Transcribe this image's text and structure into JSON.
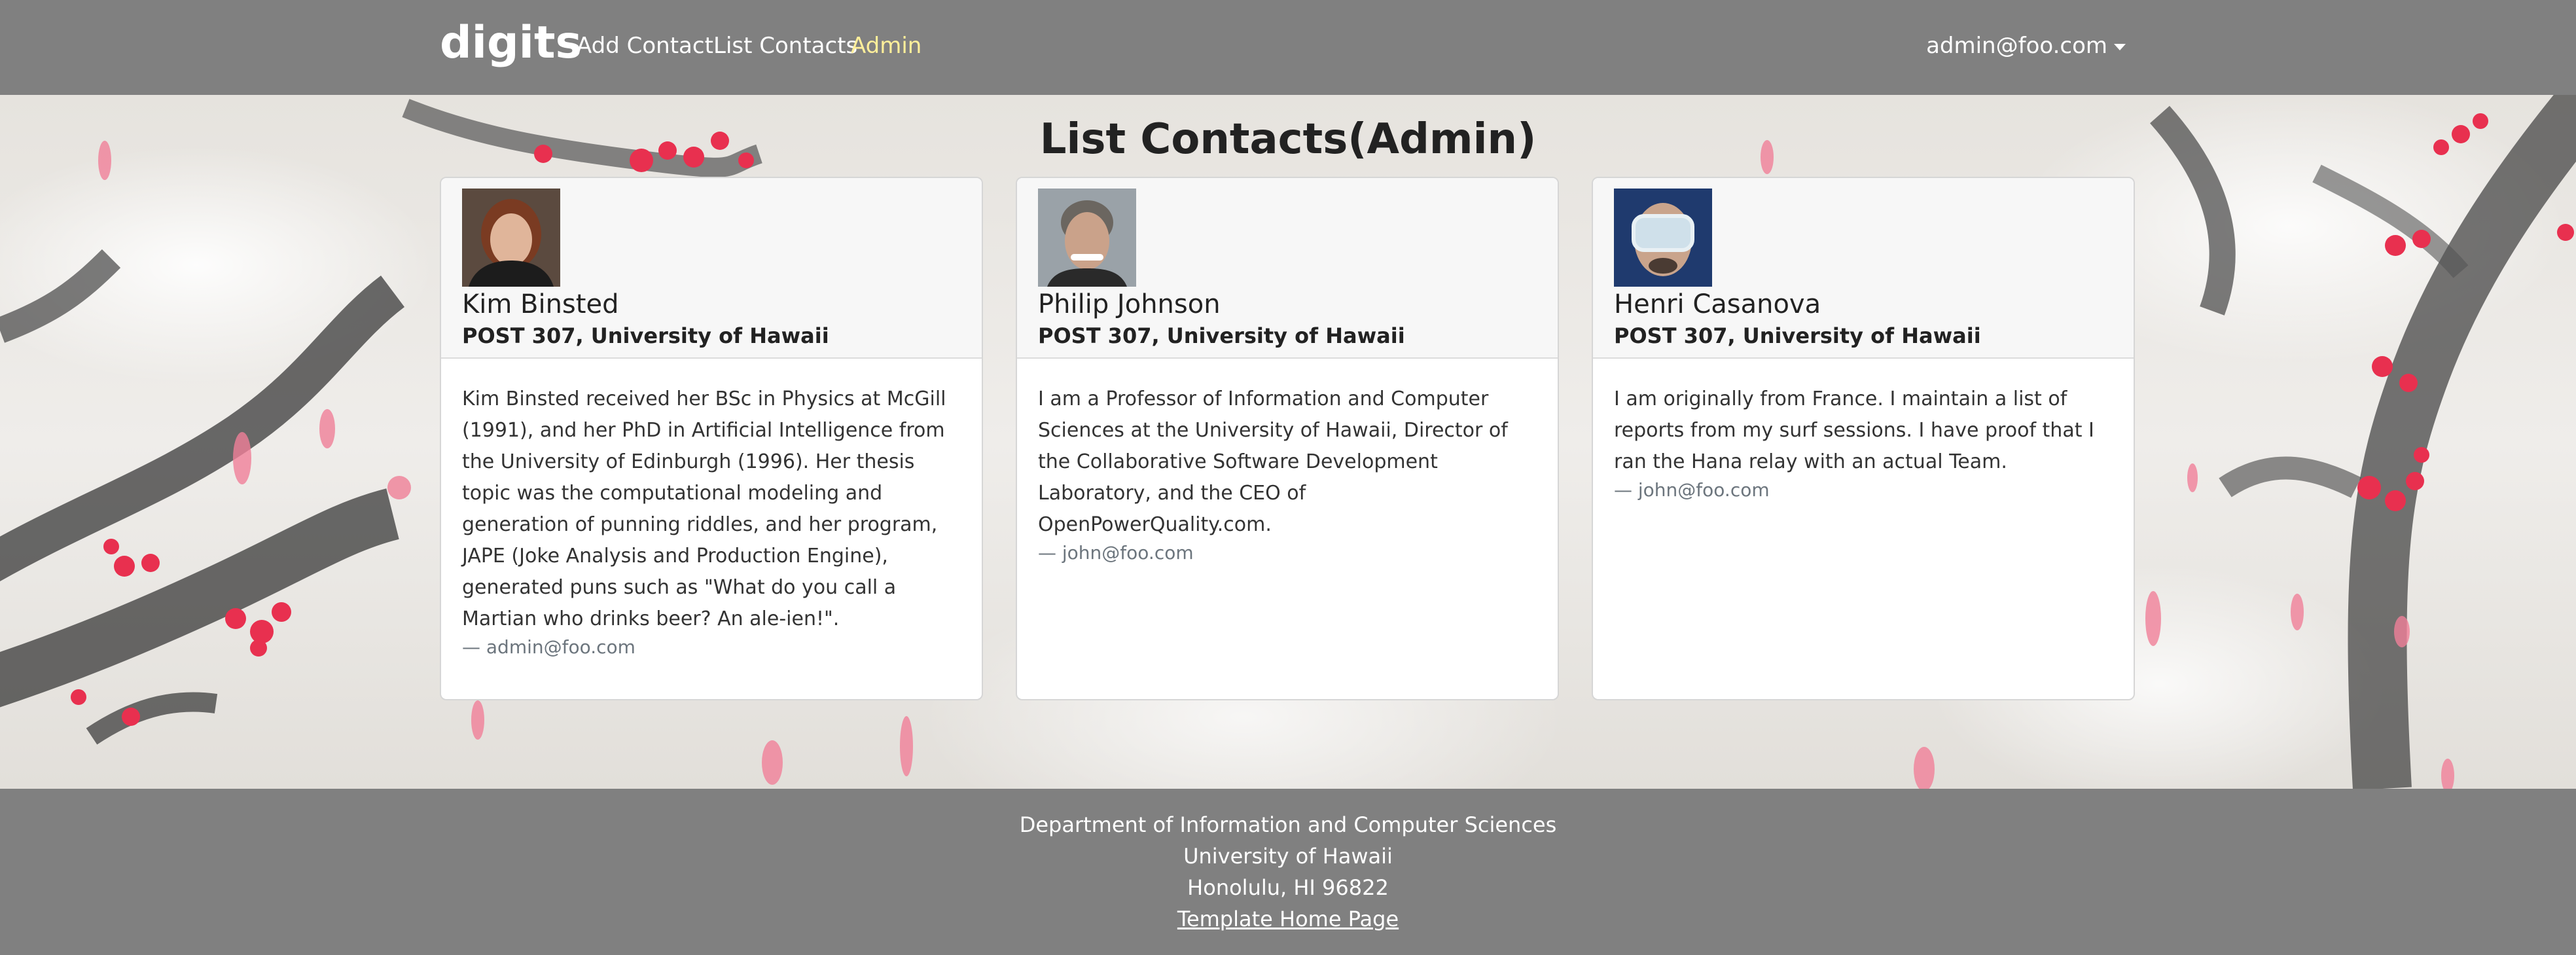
{
  "navbar": {
    "brand": "digits",
    "links": [
      "Add Contact",
      "List Contacts",
      "Admin"
    ],
    "user": "admin@foo.com"
  },
  "page_title": "List Contacts(Admin)",
  "contacts": [
    {
      "name": "Kim Binsted",
      "address": "POST 307, University of Hawaii",
      "description": "Kim Binsted received her BSc in Physics at McGill (1991), and her PhD in Artificial Intelligence from the University of Edinburgh (1996). Her thesis topic was the computational modeling and generation of punning riddles, and her program, JAPE (Joke Analysis and Production Engine), generated puns such as \"What do you call a Martian who drinks beer? An ale-ien!\".",
      "owner": "— admin@foo.com"
    },
    {
      "name": "Philip Johnson",
      "address": "POST 307, University of Hawaii",
      "description": "I am a Professor of Information and Computer Sciences at the University of Hawaii, Director of the Collaborative Software Development Laboratory, and the CEO of OpenPowerQuality.com.",
      "owner": "— john@foo.com"
    },
    {
      "name": "Henri Casanova",
      "address": "POST 307, University of Hawaii",
      "description": "I am originally from France. I maintain a list of reports from my surf sessions. I have proof that I ran the Hana relay with an actual Team.",
      "owner": "— john@foo.com"
    }
  ],
  "footer": {
    "line1": "Department of Information and Computer Sciences",
    "line2": "University of Hawaii",
    "line3": "Honolulu, HI 96822",
    "link": "Template Home Page"
  },
  "colors": {
    "navbar": "#808080",
    "active_link": "#ffef9a",
    "blossom": "#e8304f"
  }
}
